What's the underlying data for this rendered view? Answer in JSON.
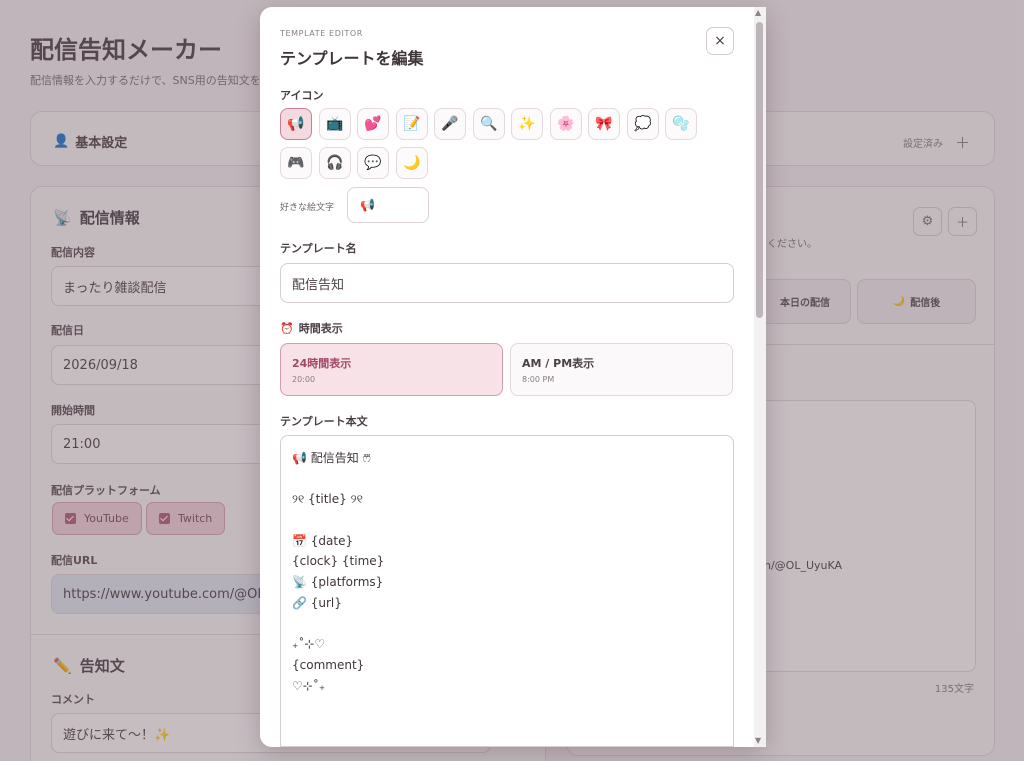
{
  "app": {
    "title": "配信告知メーカー",
    "subtitle": "配信情報を入力するだけで、SNS用の告知文を",
    "basic_settings": {
      "title": "基本設定",
      "status": "設定済み",
      "action": "＋"
    },
    "stream_info": {
      "title": "配信情報",
      "content_label": "配信内容",
      "content_value": "まったり雑談配信",
      "date_label": "配信日",
      "date_value": "2026/09/18",
      "start_label": "開始時間",
      "start_value": "21:00",
      "platform_label": "配信プラットフォーム",
      "platforms": [
        "YouTube",
        "Twitch"
      ],
      "url_label": "配信URL",
      "url_value": "https://www.youtube.com/@OL_UyuKA"
    },
    "notice": {
      "title": "告知文",
      "comment_label": "コメント",
      "comment_value": "遊びに来て〜！✨"
    },
    "right": {
      "hint": "ください。",
      "settings_icon": "⚙",
      "add_icon": "＋",
      "tab_today": "本日の配信",
      "tab_after": "配信後",
      "preview_url": "n/@OL_UyuKA",
      "char_count": "135文字"
    }
  },
  "modal": {
    "eyebrow": "TEMPLATE EDITOR",
    "title": "テンプレートを編集",
    "close": "×",
    "icon_label": "アイコン",
    "icons": [
      "📢",
      "📺",
      "💕",
      "📝",
      "🎤",
      "🔍",
      "✨",
      "🌸",
      "🎀",
      "💭",
      "🫧",
      "🎮",
      "🎧",
      "💬",
      "🌙"
    ],
    "selected_icon": 0,
    "fav_emoji_label": "好きな絵文字",
    "fav_emoji_value": "📢",
    "template_name_label": "テンプレート名",
    "template_name_value": "配信告知",
    "time_display_label": "時間表示",
    "time_options": [
      {
        "label": "24時間表示",
        "sample": "20:00",
        "selected": true
      },
      {
        "label": "AM / PM表示",
        "sample": "8:00 PM",
        "selected": false
      }
    ],
    "body_label": "テンプレート本文",
    "body_lines": [
      "📢 配信告知 ෆ⃛",
      "",
      "୨୧ {title} ୨୧",
      "",
      "📅 {date}",
      "{clock} {time}",
      "📡 {platforms}",
      "🔗 {url}",
      "",
      "₊˚⊹♡",
      "{comment}",
      "♡⊹˚₊"
    ]
  }
}
